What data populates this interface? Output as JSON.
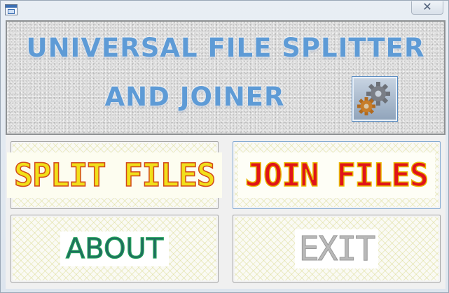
{
  "window": {
    "close_glyph": "✕",
    "icons": {
      "app": "app-window-icon",
      "close": "close-icon"
    }
  },
  "header": {
    "title_line_1": "UNIVERSAL FILE SPLITTER",
    "title_line_2": "AND JOINER",
    "title_color": "#5e9bd6",
    "settings_icon": "gears-icon"
  },
  "buttons": {
    "split_label": "SPLIT FILES",
    "join_label": "JOIN FILES",
    "about_label": "ABOUT",
    "exit_label": "EXIT"
  },
  "colors": {
    "split_fill": "#f1e01a",
    "join_fill": "#e0141a",
    "about_fill": "#1f6b5e",
    "exit_fill": "#b9b9b9"
  }
}
